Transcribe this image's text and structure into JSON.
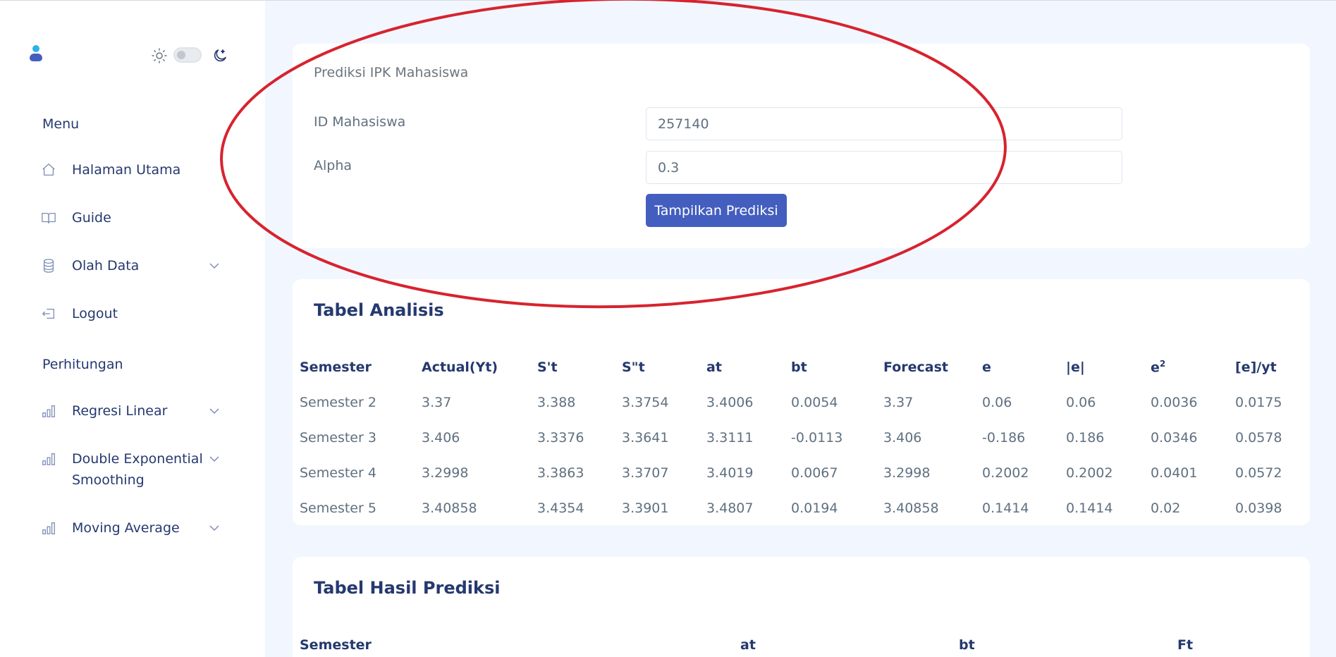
{
  "sidebar": {
    "menu_title": "Menu",
    "items": [
      {
        "label": "Halaman Utama",
        "icon": "home-icon"
      },
      {
        "label": "Guide",
        "icon": "book-icon"
      },
      {
        "label": "Olah Data",
        "icon": "database-icon"
      },
      {
        "label": "Logout",
        "icon": "logout-icon"
      }
    ],
    "calc_title": "Perhitungan",
    "calc_items": [
      {
        "label": "Regresi Linear",
        "icon": "bar-chart-icon"
      },
      {
        "label": "Double Exponential Smoothing",
        "icon": "bar-chart-icon"
      },
      {
        "label": "Moving Average",
        "icon": "bar-chart-icon"
      }
    ]
  },
  "form": {
    "subtitle": "Prediksi IPK Mahasiswa",
    "id_label": "ID Mahasiswa",
    "id_value": "257140",
    "alpha_label": "Alpha",
    "alpha_value": "0.3",
    "submit_label": "Tampilkan Prediksi"
  },
  "analisis": {
    "title": "Tabel Analisis",
    "headers": [
      "Semester",
      "Actual(Yt)",
      "S't",
      "S\"t",
      "at",
      "bt",
      "Forecast",
      "e",
      "|e|",
      "e",
      "[e]/yt"
    ],
    "rows": [
      [
        "Semester 2",
        "3.37",
        "3.388",
        "3.3754",
        "3.4006",
        "0.0054",
        "3.37",
        "0.06",
        "0.06",
        "0.0036",
        "0.0175"
      ],
      [
        "Semester 3",
        "3.406",
        "3.3376",
        "3.3641",
        "3.3111",
        "-0.0113",
        "3.406",
        "-0.186",
        "0.186",
        "0.0346",
        "0.0578"
      ],
      [
        "Semester 4",
        "3.2998",
        "3.3863",
        "3.3707",
        "3.4019",
        "0.0067",
        "3.2998",
        "0.2002",
        "0.2002",
        "0.0401",
        "0.0572"
      ],
      [
        "Semester 5",
        "3.40858",
        "3.4354",
        "3.3901",
        "3.4807",
        "0.0194",
        "3.40858",
        "0.1414",
        "0.1414",
        "0.02",
        "0.0398"
      ]
    ]
  },
  "hasil": {
    "title": "Tabel Hasil Prediksi",
    "headers": [
      "Semester",
      "at",
      "bt",
      "Ft"
    ]
  },
  "colors": {
    "primary": "#435ebe",
    "background": "#f2f7ff",
    "annotation": "#d7232e"
  }
}
